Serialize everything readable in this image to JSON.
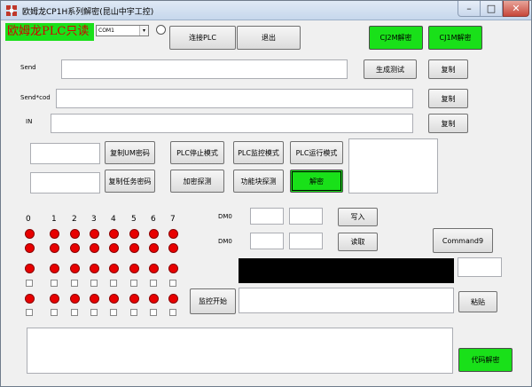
{
  "window": {
    "title": "欧姆龙CP1H系列解密(昆山中宇工控)",
    "minimize": "–",
    "maximize": "□",
    "close": "✕"
  },
  "brand": "欧姆龙PLC只读",
  "port": {
    "value": "COM1",
    "arrow": "▾"
  },
  "buttons": {
    "connect": "连接PLC",
    "exit": "退出",
    "cj2m": "CJ2M解密",
    "cj1m": "CJ1M解密",
    "generate_test": "生成测试",
    "copy1": "复制",
    "copy2": "复制",
    "copy3": "复制",
    "copy_um": "复制UM密码",
    "copy_task": "复制任务密码",
    "plc_stop": "PLC停止模式",
    "plc_monitor": "PLC监控模式",
    "plc_run": "PLC运行模式",
    "encrypt_probe": "加密探测",
    "fb_probe": "功能块探测",
    "decrypt": "解密",
    "write": "写入",
    "read": "读取",
    "command9": "Command9",
    "monitor_start": "监控开始",
    "paste": "粘贴",
    "code_decrypt": "代码解密"
  },
  "labels": {
    "send": "Send",
    "sendcod": "Send*cod",
    "in": "IN",
    "dm0_a": "DM0",
    "dm0_b": "DM0"
  },
  "bits": [
    "0",
    "1",
    "2",
    "3",
    "4",
    "5",
    "6",
    "7"
  ],
  "colors": {
    "led": "#e80000",
    "green_button": "#19e019",
    "brand_text": "#d40000"
  }
}
